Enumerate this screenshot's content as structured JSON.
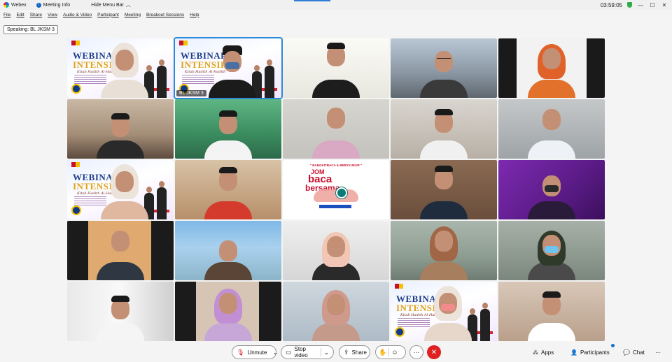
{
  "window": {
    "app_title": "Webex",
    "meeting_info": "Meeting Info",
    "hide_menu_bar": "Hide Menu Bar",
    "timer": "03:59:05",
    "controls": [
      "—",
      "☐",
      "✕"
    ]
  },
  "menu": [
    "File",
    "Edit",
    "Share",
    "View",
    "Audio & Video",
    "Participant",
    "Meeting",
    "Breakout Sessions",
    "Help"
  ],
  "speaking": {
    "label": "Speaking: BL JKSM 3"
  },
  "tiles": [
    {
      "kind": "poster"
    },
    {
      "kind": "poster",
      "label": "BL JKSM 3",
      "active": true
    },
    {
      "kind": "person"
    },
    {
      "kind": "person"
    },
    {
      "kind": "person"
    },
    {
      "kind": "person"
    },
    {
      "kind": "person"
    },
    {
      "kind": "person"
    },
    {
      "kind": "person"
    },
    {
      "kind": "person"
    },
    {
      "kind": "poster"
    },
    {
      "kind": "person"
    },
    {
      "kind": "baca"
    },
    {
      "kind": "person"
    },
    {
      "kind": "person"
    },
    {
      "kind": "person"
    },
    {
      "kind": "person"
    },
    {
      "kind": "person"
    },
    {
      "kind": "person"
    },
    {
      "kind": "person"
    },
    {
      "kind": "person"
    },
    {
      "kind": "person"
    },
    {
      "kind": "person"
    },
    {
      "kind": "poster"
    },
    {
      "kind": "person"
    }
  ],
  "poster": {
    "word1": "WEBINAR",
    "word2": "INTENSIF",
    "subtitle": "Kitab Hadith Al-Hadith"
  },
  "baca": {
    "top": "\" BANGKITBACA & BERSYUKUR \"",
    "jom": "JOM",
    "baca": "baca",
    "bersama": "bersama",
    "number": "10"
  },
  "controlbar": {
    "unmute": "Unmute",
    "stop_video": "Stop video",
    "share": "Share",
    "apps": "Apps",
    "participants": "Participants",
    "chat": "Chat",
    "more": "···"
  },
  "colors": {
    "accent": "#1170cf",
    "end_call": "#e02020",
    "active_tile": "#2a8ad9"
  }
}
